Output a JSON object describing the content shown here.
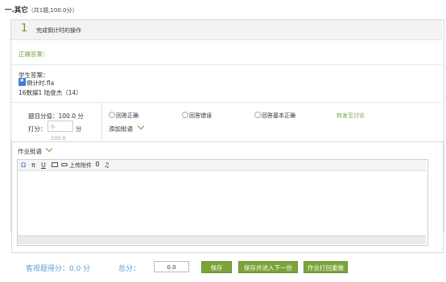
{
  "section": {
    "title": "一.其它",
    "subtitle": "（共1题,100.0分）"
  },
  "question": {
    "number": "1",
    "title": "完成倒计时的操作",
    "answer_label": "正确答案：",
    "student_answer_label": "学生答案：",
    "file_icon": "flash-file-icon",
    "file_name": "倒计时.fla",
    "student_info": "16数媒1 陆俊杰（14）"
  },
  "grading": {
    "score_label": "题目分值：100.0 分",
    "give_label": "打分：",
    "score_placeholder": "0-100.0",
    "fen": "分",
    "options": [
      "回答正确",
      "回答错误",
      "回答基本正确"
    ],
    "discuss_link": "转发至讨论",
    "add_comment": "添加批语"
  },
  "homework": {
    "title": "作业批语",
    "toolbar": {
      "omega": "Ω",
      "pi": "π",
      "underline": "U",
      "upload_label": "上传附件"
    }
  },
  "footer": {
    "objective_score": "客观题得分：0.0 分",
    "total_label": "总分：",
    "total_value": "0.0",
    "buttons": [
      "保存",
      "保存并进入下一份",
      "作业打回重做"
    ]
  },
  "colors": {
    "accent": "#7aa33a",
    "link_blue": "#5a9fd4"
  }
}
